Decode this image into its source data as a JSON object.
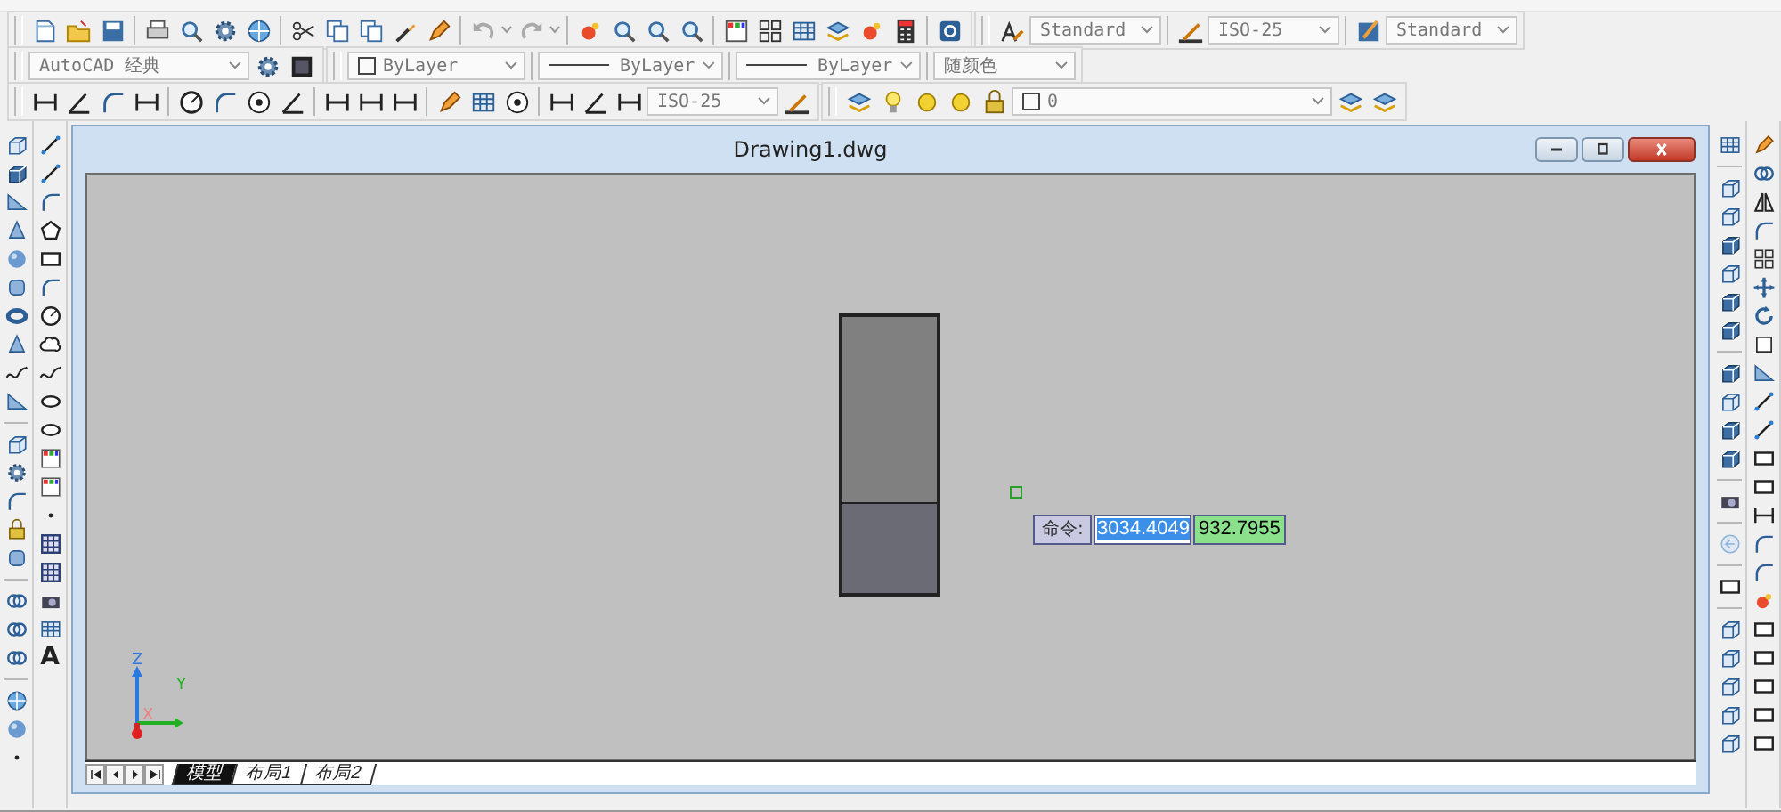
{
  "toolbar_row_1": {
    "text_style": "Standard",
    "dim_style": "ISO-25",
    "table_style": "Standard"
  },
  "toolbar_row_2": {
    "workspace": "AutoCAD 经典",
    "layer_color": "ByLayer",
    "linetype": "ByLayer",
    "lineweight": "ByLayer",
    "plot_style": "随颜色"
  },
  "toolbar_row_3": {
    "dim_style": "ISO-25",
    "layer": "0"
  },
  "draw_toolbar": {
    "text_tool": "A"
  },
  "drawing_window": {
    "title": "Drawing1.dwg",
    "ucs": {
      "z": "Z",
      "y": "Y",
      "x": "X"
    },
    "dynamic_input": {
      "prompt": "命令:",
      "x_value": "3034.4049",
      "y_value": "932.7955"
    },
    "tabs": [
      {
        "label": "模型",
        "selected": true
      },
      {
        "label": "布局1",
        "selected": false
      },
      {
        "label": "布局2",
        "selected": false
      }
    ]
  }
}
